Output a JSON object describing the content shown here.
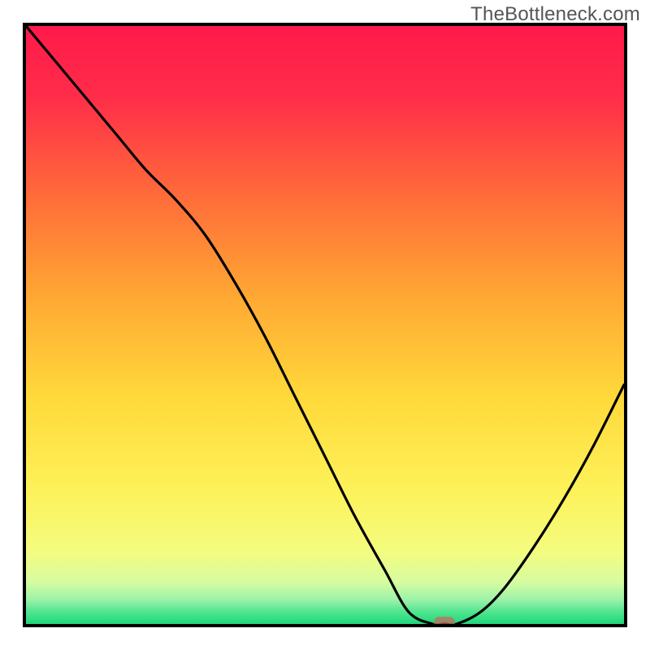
{
  "watermark": "TheBottleneck.com",
  "chart_data": {
    "type": "line",
    "title": "",
    "xlabel": "",
    "ylabel": "",
    "x_range": [
      0,
      100
    ],
    "y_range": [
      0,
      100
    ],
    "series": [
      {
        "name": "bottleneck-curve",
        "x": [
          0,
          5,
          10,
          15,
          20,
          25,
          30,
          35,
          40,
          45,
          50,
          55,
          60,
          64,
          68,
          70,
          72,
          76,
          80,
          85,
          90,
          95,
          100
        ],
        "y": [
          100,
          94,
          88,
          82,
          76,
          71,
          65,
          57,
          48,
          38,
          28,
          18,
          9,
          2,
          0,
          0,
          0,
          2,
          6,
          13,
          21,
          30,
          40
        ]
      }
    ],
    "optimal_marker": {
      "x": 70,
      "y": 0
    },
    "gradient_stops": [
      {
        "pct": 0,
        "color": "#ff1a4b"
      },
      {
        "pct": 12,
        "color": "#ff2d49"
      },
      {
        "pct": 28,
        "color": "#ff6a3a"
      },
      {
        "pct": 45,
        "color": "#ffa733"
      },
      {
        "pct": 62,
        "color": "#ffd93a"
      },
      {
        "pct": 78,
        "color": "#fdf25a"
      },
      {
        "pct": 88,
        "color": "#f4fc80"
      },
      {
        "pct": 93,
        "color": "#d6fca0"
      },
      {
        "pct": 96,
        "color": "#9af2a8"
      },
      {
        "pct": 98,
        "color": "#4fe58f"
      },
      {
        "pct": 100,
        "color": "#1fd67a"
      }
    ]
  }
}
